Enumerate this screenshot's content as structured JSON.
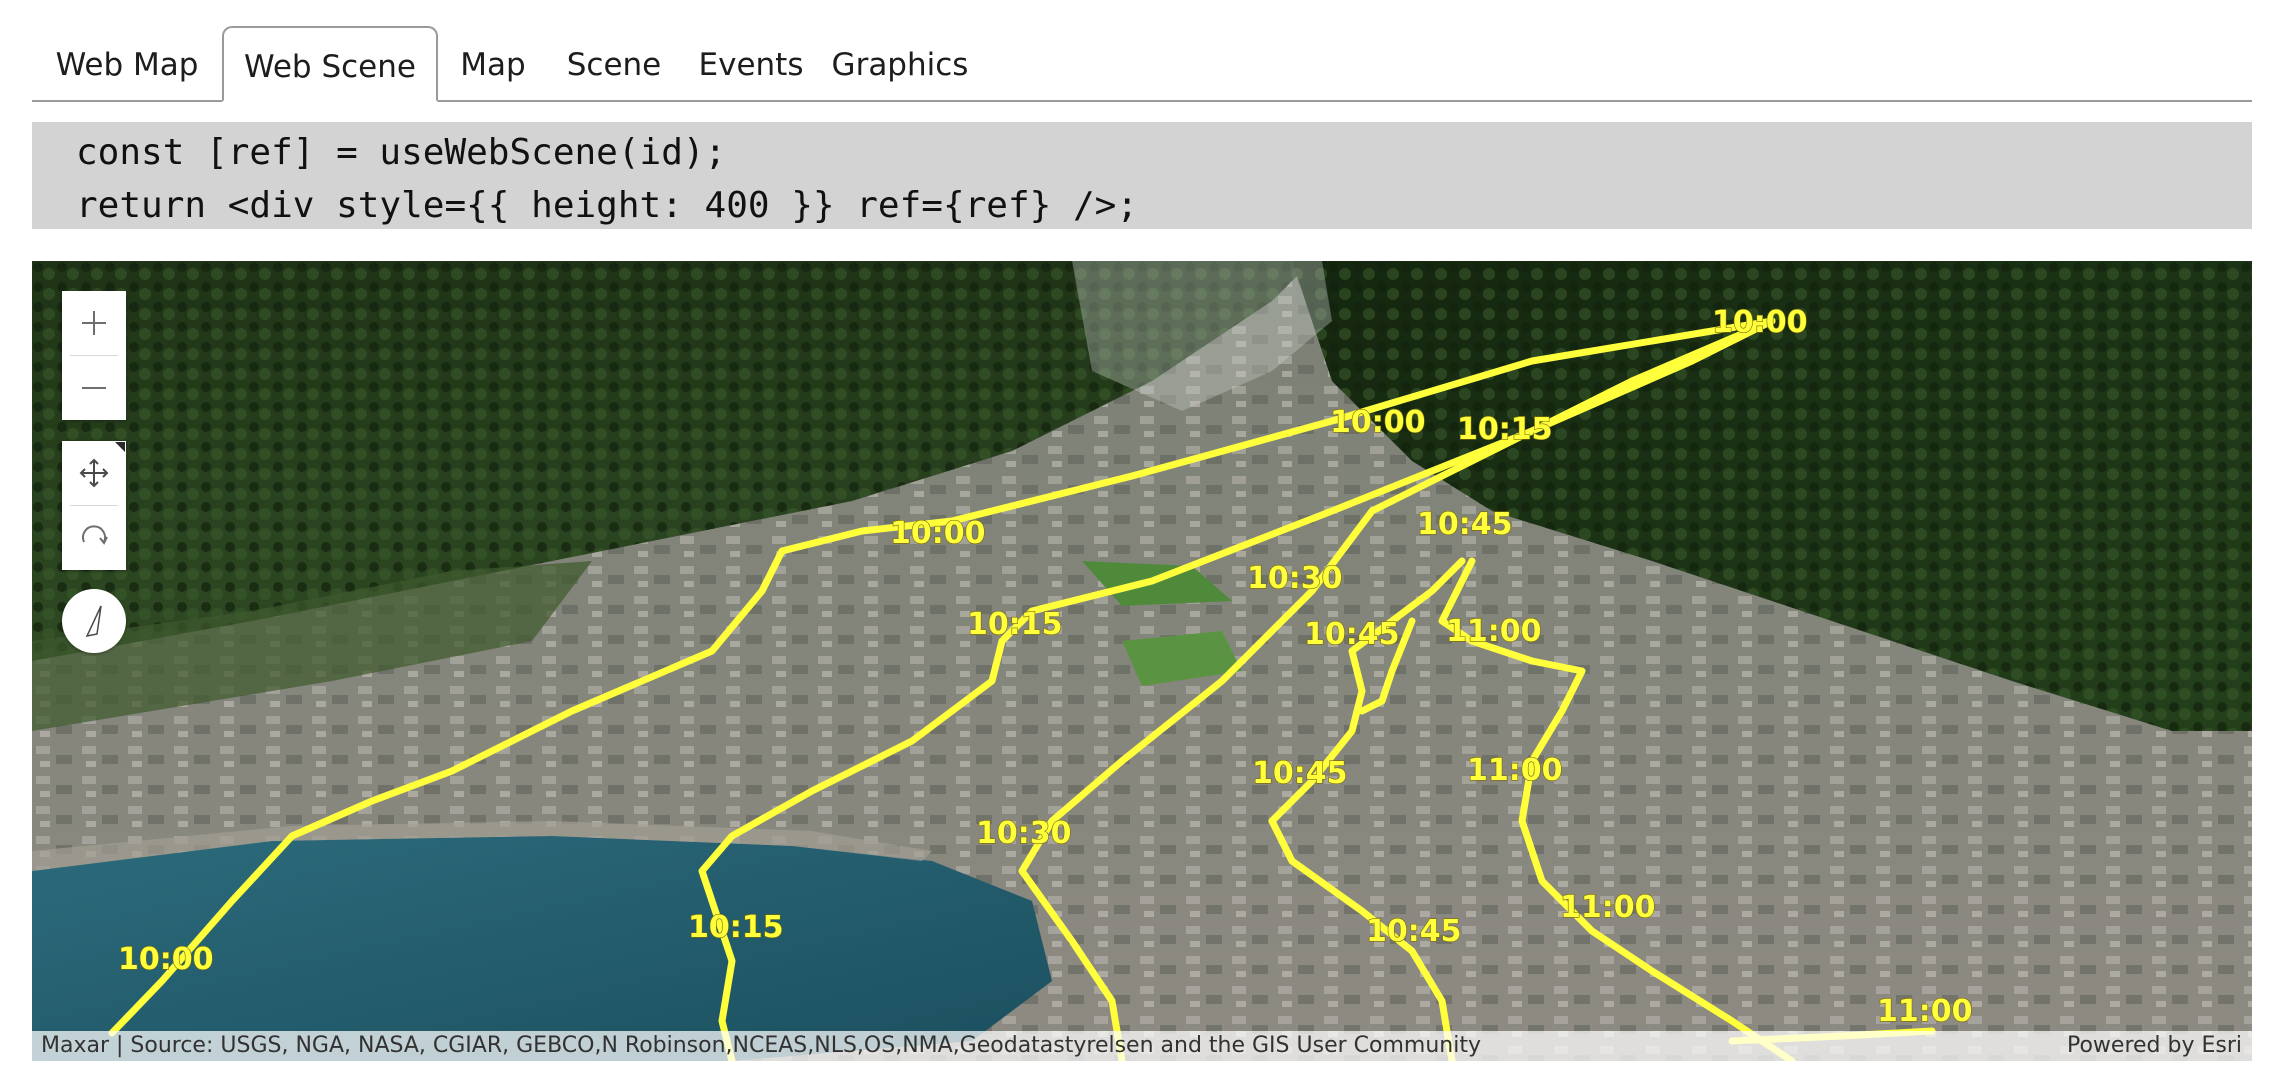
{
  "tabs": [
    {
      "label": "Web Map",
      "active": false
    },
    {
      "label": "Web Scene",
      "active": true
    },
    {
      "label": "Map",
      "active": false
    },
    {
      "label": "Scene",
      "active": false
    },
    {
      "label": "Events",
      "active": false
    },
    {
      "label": "Graphics",
      "active": false
    }
  ],
  "code": {
    "line1": "const [ref] = useWebScene(id);",
    "line2": "return <div style={{ height: 400 }} ref={ref} />;"
  },
  "scene": {
    "controls": {
      "zoom_in_icon": "plus-icon",
      "zoom_out_icon": "minus-icon",
      "pan_icon": "move-arrows-icon",
      "rotate_icon": "rotate-icon",
      "compass_icon": "compass-needle-icon"
    },
    "track_color": "#ffff3c",
    "time_labels": [
      "10:00",
      "10:00",
      "10:15",
      "10:00",
      "10:45",
      "10:15",
      "10:30",
      "10:45",
      "11:00",
      "10:00",
      "10:15",
      "10:30",
      "10:45",
      "11:00",
      "11:00",
      "10:45",
      "11:00"
    ],
    "attribution": "Maxar | Source: USGS, NGA, NASA, CGIAR, GEBCO,N Robinson,NCEAS,NLS,OS,NMA,Geodatastyrelsen and the GIS User Community",
    "powered_by": "Powered by Esri"
  }
}
